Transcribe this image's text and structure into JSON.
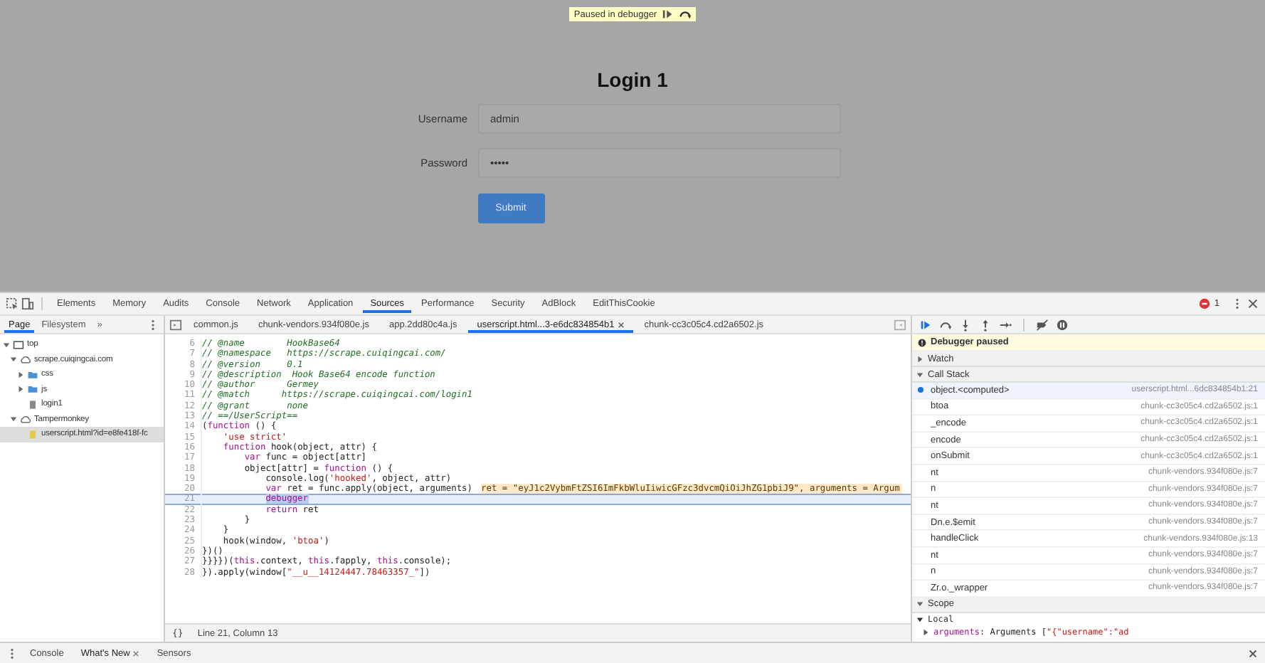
{
  "page": {
    "banner": {
      "text": "Paused in debugger"
    },
    "title": "Login 1",
    "fields": [
      {
        "label": "Username",
        "value": "admin"
      },
      {
        "label": "Password",
        "value": "•••••"
      }
    ],
    "submit": "Submit"
  },
  "devtools": {
    "tabs": [
      {
        "label": "Elements",
        "selected": false
      },
      {
        "label": "Memory",
        "selected": false
      },
      {
        "label": "Audits",
        "selected": false
      },
      {
        "label": "Console",
        "selected": false
      },
      {
        "label": "Network",
        "selected": false
      },
      {
        "label": "Application",
        "selected": false
      },
      {
        "label": "Sources",
        "selected": true
      },
      {
        "label": "Performance",
        "selected": false
      },
      {
        "label": "Security",
        "selected": false
      },
      {
        "label": "AdBlock",
        "selected": false
      },
      {
        "label": "EditThisCookie",
        "selected": false
      }
    ],
    "error_count": "1",
    "navigator": {
      "tabs": [
        {
          "label": "Page",
          "selected": true
        },
        {
          "label": "Filesystem",
          "selected": false
        }
      ],
      "more": "»",
      "tree": [
        {
          "label": "top",
          "kind": "frame",
          "expanded": true,
          "selected": false,
          "children": [
            {
              "label": "scrape.cuiqingcai.com",
              "kind": "domain",
              "expanded": true,
              "selected": false,
              "children": [
                {
                  "label": "css",
                  "kind": "folder",
                  "expanded": false,
                  "selected": false
                },
                {
                  "label": "js",
                  "kind": "folder",
                  "expanded": false,
                  "selected": false
                },
                {
                  "label": "login1",
                  "kind": "file",
                  "selected": false
                }
              ]
            },
            {
              "label": "Tampermonkey",
              "kind": "domain",
              "expanded": true,
              "selected": false,
              "children": [
                {
                  "label": "userscript.html?id=e8fe418f-fc",
                  "kind": "script",
                  "selected": true
                }
              ]
            }
          ]
        }
      ]
    },
    "editor": {
      "tabs": [
        {
          "label": "common.js",
          "selected": false,
          "closable": false
        },
        {
          "label": "chunk-vendors.934f080e.js",
          "selected": false,
          "closable": false
        },
        {
          "label": "app.2dd80c4a.js",
          "selected": false,
          "closable": false
        },
        {
          "label": "userscript.html...3-e6dc834854b1",
          "selected": true,
          "closable": true
        },
        {
          "label": "chunk-cc3c05c4.cd2a6502.js",
          "selected": false,
          "closable": false
        }
      ],
      "lines": [
        {
          "number": "6",
          "current": false,
          "tokens": [
            {
              "kind": "comment",
              "text": "// @name        HookBase64"
            }
          ]
        },
        {
          "number": "7",
          "current": false,
          "tokens": [
            {
              "kind": "comment",
              "text": "// @namespace   https://scrape.cuiqingcai.com/"
            }
          ]
        },
        {
          "number": "8",
          "current": false,
          "tokens": [
            {
              "kind": "comment",
              "text": "// @version     0.1"
            }
          ]
        },
        {
          "number": "9",
          "current": false,
          "tokens": [
            {
              "kind": "comment",
              "text": "// @description  Hook Base64 encode function"
            }
          ]
        },
        {
          "number": "10",
          "current": false,
          "tokens": [
            {
              "kind": "comment",
              "text": "// @author      Germey"
            }
          ]
        },
        {
          "number": "11",
          "current": false,
          "tokens": [
            {
              "kind": "comment",
              "text": "// @match      https://scrape.cuiqingcai.com/login1"
            }
          ]
        },
        {
          "number": "12",
          "current": false,
          "tokens": [
            {
              "kind": "comment",
              "text": "// @grant       none"
            }
          ]
        },
        {
          "number": "13",
          "current": false,
          "tokens": [
            {
              "kind": "comment",
              "text": "// ==/UserScript=="
            }
          ]
        },
        {
          "number": "14",
          "current": false,
          "tokens": [
            {
              "kind": "plain",
              "text": "("
            },
            {
              "kind": "keyword",
              "text": "function"
            },
            {
              "kind": "plain",
              "text": " () {"
            }
          ]
        },
        {
          "number": "15",
          "current": false,
          "tokens": [
            {
              "kind": "string",
              "text": "    'use strict'"
            }
          ]
        },
        {
          "number": "16",
          "current": false,
          "tokens": [
            {
              "kind": "keyword",
              "text": "    function"
            },
            {
              "kind": "plain",
              "text": " hook(object, attr) {"
            }
          ]
        },
        {
          "number": "17",
          "current": false,
          "tokens": [
            {
              "kind": "keyword",
              "text": "        var"
            },
            {
              "kind": "plain",
              "text": " func = object[attr]"
            }
          ]
        },
        {
          "number": "18",
          "current": false,
          "tokens": [
            {
              "kind": "plain",
              "text": "        object[attr] = "
            },
            {
              "kind": "keyword",
              "text": "function"
            },
            {
              "kind": "plain",
              "text": " () {"
            }
          ]
        },
        {
          "number": "19",
          "current": false,
          "tokens": [
            {
              "kind": "plain",
              "text": "            console.log("
            },
            {
              "kind": "string",
              "text": "'hooked'"
            },
            {
              "kind": "plain",
              "text": ", object, attr)"
            }
          ]
        },
        {
          "number": "20",
          "current": false,
          "tokens": [
            {
              "kind": "keyword",
              "text": "            var"
            },
            {
              "kind": "plain",
              "text": " ret = func.apply(object, arguments)"
            }
          ],
          "inline_value": "ret = \"eyJ1c2VybmFtZSI6ImFkbWluIiwicGFzc3dvcmQiOiJhZG1pbiJ9\", arguments = Argum"
        },
        {
          "number": "21",
          "current": true,
          "tokens": [
            {
              "kind": "keyword",
              "text": "            debugger"
            }
          ]
        },
        {
          "number": "22",
          "current": false,
          "tokens": [
            {
              "kind": "keyword",
              "text": "            return"
            },
            {
              "kind": "plain",
              "text": " ret"
            }
          ]
        },
        {
          "number": "23",
          "current": false,
          "tokens": [
            {
              "kind": "plain",
              "text": "        }"
            }
          ]
        },
        {
          "number": "24",
          "current": false,
          "tokens": [
            {
              "kind": "plain",
              "text": "    }"
            }
          ]
        },
        {
          "number": "25",
          "current": false,
          "tokens": [
            {
              "kind": "plain",
              "text": "    hook(window, "
            },
            {
              "kind": "string",
              "text": "'btoa'"
            },
            {
              "kind": "plain",
              "text": ")"
            }
          ]
        },
        {
          "number": "26",
          "current": false,
          "tokens": [
            {
              "kind": "plain",
              "text": "})()"
            }
          ]
        },
        {
          "number": "27",
          "current": false,
          "tokens": [
            {
              "kind": "plain",
              "text": "}}}})("
            },
            {
              "kind": "keyword",
              "text": "this"
            },
            {
              "kind": "plain",
              "text": ".context, "
            },
            {
              "kind": "keyword",
              "text": "this"
            },
            {
              "kind": "plain",
              "text": ".fapply, "
            },
            {
              "kind": "keyword",
              "text": "this"
            },
            {
              "kind": "plain",
              "text": ".console);"
            }
          ]
        },
        {
          "number": "28",
          "current": false,
          "tokens": [
            {
              "kind": "plain",
              "text": "}).apply(window["
            },
            {
              "kind": "string",
              "text": "\"__u__14124447.78463357_\""
            },
            {
              "kind": "plain",
              "text": "])"
            }
          ]
        }
      ],
      "pretty_print": "{}",
      "status": "Line 21, Column 13"
    },
    "debugger": {
      "paused_message": "Debugger paused",
      "watch": {
        "title": "Watch",
        "expanded": false
      },
      "call_stack": {
        "title": "Call Stack",
        "expanded": true,
        "items": [
          {
            "name": "object.<computed>",
            "location": "userscript.html...6dc834854b1:21",
            "current": true
          },
          {
            "name": "btoa",
            "location": "chunk-cc3c05c4.cd2a6502.js:1",
            "current": false
          },
          {
            "name": "_encode",
            "location": "chunk-cc3c05c4.cd2a6502.js:1",
            "current": false
          },
          {
            "name": "encode",
            "location": "chunk-cc3c05c4.cd2a6502.js:1",
            "current": false
          },
          {
            "name": "onSubmit",
            "location": "chunk-cc3c05c4.cd2a6502.js:1",
            "current": false
          },
          {
            "name": "nt",
            "location": "chunk-vendors.934f080e.js:7",
            "current": false
          },
          {
            "name": "n",
            "location": "chunk-vendors.934f080e.js:7",
            "current": false
          },
          {
            "name": "nt",
            "location": "chunk-vendors.934f080e.js:7",
            "current": false
          },
          {
            "name": "Dn.e.$emit",
            "location": "chunk-vendors.934f080e.js:7",
            "current": false
          },
          {
            "name": "handleClick",
            "location": "chunk-vendors.934f080e.js:13",
            "current": false
          },
          {
            "name": "nt",
            "location": "chunk-vendors.934f080e.js:7",
            "current": false
          },
          {
            "name": "n",
            "location": "chunk-vendors.934f080e.js:7",
            "current": false
          },
          {
            "name": "Zr.o._wrapper",
            "location": "chunk-vendors.934f080e.js:7",
            "current": false
          }
        ]
      },
      "scope": {
        "title": "Scope",
        "expanded": true,
        "local": {
          "title": "Local",
          "expanded": true,
          "items": [
            {
              "expanded": false,
              "tokens": [
                {
                  "kind": "keyword",
                  "text": "arguments"
                },
                {
                  "kind": "plain",
                  "text": ": Arguments ["
                },
                {
                  "kind": "string",
                  "text": "\"{\"username\":\"ad"
                }
              ]
            }
          ]
        }
      }
    },
    "drawer": {
      "tabs": [
        {
          "label": "Console",
          "selected": false,
          "closable": false
        },
        {
          "label": "What's New",
          "selected": true,
          "closable": true
        },
        {
          "label": "Sensors",
          "selected": false,
          "closable": false
        }
      ]
    }
  }
}
